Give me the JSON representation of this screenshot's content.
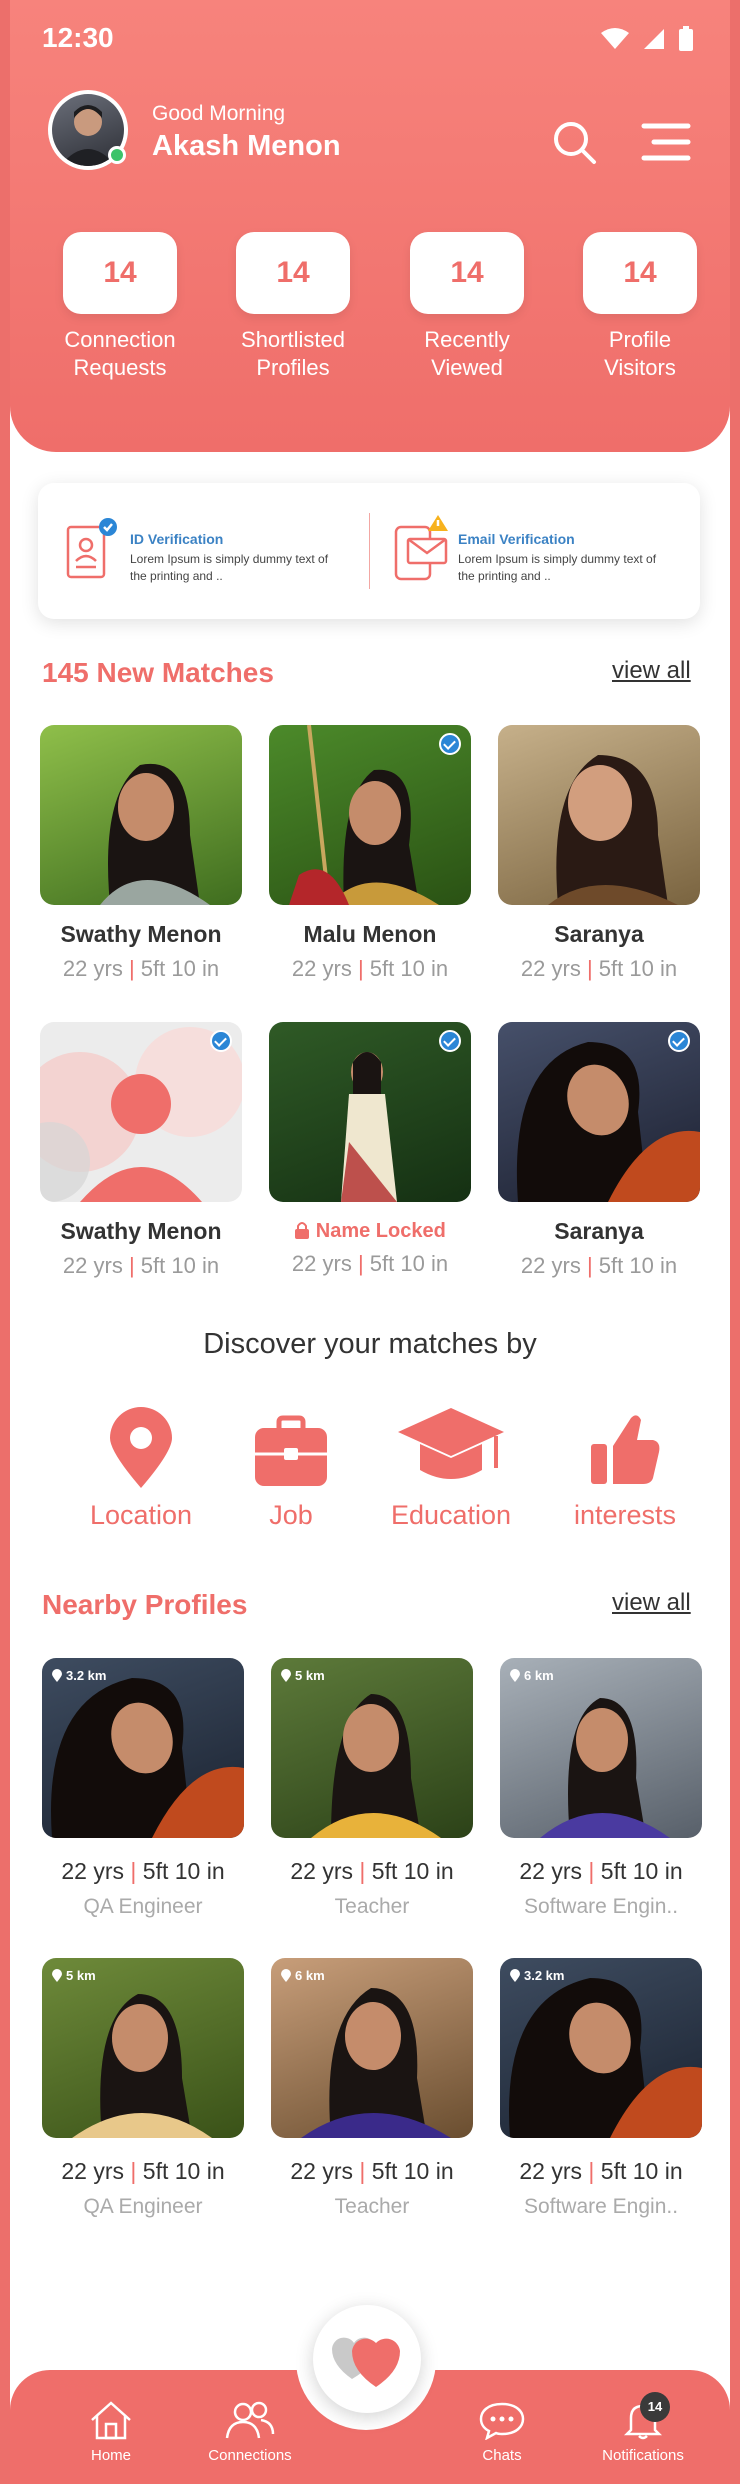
{
  "status_bar": {
    "time": "12:30"
  },
  "header": {
    "greeting": "Good Morning",
    "user_name": "Akash Menon",
    "stats": [
      {
        "value": "14",
        "label_line1": "Connection",
        "label_line2": "Requests"
      },
      {
        "value": "14",
        "label_line1": "Shortlisted",
        "label_line2": "Profiles"
      },
      {
        "value": "14",
        "label_line1": "Recently",
        "label_line2": "Viewed"
      },
      {
        "value": "14",
        "label_line1": "Profile",
        "label_line2": "Visitors"
      }
    ]
  },
  "verification": [
    {
      "title": "ID Verification",
      "desc": "Lorem Ipsum is simply dummy text of the printing and .."
    },
    {
      "title": "Email Verification",
      "desc": "Lorem Ipsum is simply dummy text of the printing and .."
    }
  ],
  "new_matches": {
    "title": "145 New Matches",
    "view_all": "view all",
    "items": [
      {
        "name": "Swathy Menon",
        "age": "22 yrs",
        "height": "5ft 10 in",
        "verified": false
      },
      {
        "name": "Malu Menon",
        "age": "22 yrs",
        "height": "5ft 10 in",
        "verified": true
      },
      {
        "name": "Saranya",
        "age": "22 yrs",
        "height": "5ft 10 in",
        "verified": false
      },
      {
        "name": "Swathy Menon",
        "age": "22 yrs",
        "height": "5ft 10 in",
        "verified": true
      },
      {
        "name": "Name Locked",
        "age": "22 yrs",
        "height": "5ft 10 in",
        "verified": true,
        "locked": true
      },
      {
        "name": "Saranya",
        "age": "22 yrs",
        "height": "5ft 10 in",
        "verified": true
      }
    ],
    "separator": "|"
  },
  "discover": {
    "title": "Discover your matches by",
    "items": [
      {
        "label": "Location",
        "icon": "map-pin-icon"
      },
      {
        "label": "Job",
        "icon": "briefcase-icon"
      },
      {
        "label": "Education",
        "icon": "graduation-cap-icon"
      },
      {
        "label": "interests",
        "icon": "thumbs-up-icon"
      }
    ]
  },
  "nearby": {
    "title": "Nearby Profiles",
    "view_all": "view all",
    "items": [
      {
        "distance": "3.2 km",
        "age": "22 yrs",
        "height": "5ft 10 in",
        "job": "QA Engineer"
      },
      {
        "distance": "5 km",
        "age": "22 yrs",
        "height": "5ft 10 in",
        "job": "Teacher"
      },
      {
        "distance": "6 km",
        "age": "22 yrs",
        "height": "5ft 10 in",
        "job": "Software Engin.."
      },
      {
        "distance": "5 km",
        "age": "22 yrs",
        "height": "5ft 10 in",
        "job": "QA Engineer"
      },
      {
        "distance": "6 km",
        "age": "22 yrs",
        "height": "5ft 10 in",
        "job": "Teacher"
      },
      {
        "distance": "3.2 km",
        "age": "22 yrs",
        "height": "5ft 10 in",
        "job": "Software Engin.."
      }
    ]
  },
  "bottom_nav": {
    "items": [
      {
        "label": "Home",
        "icon": "home-icon"
      },
      {
        "label": "Connections",
        "icon": "people-icon"
      },
      {
        "label": "Chats",
        "icon": "chat-icon"
      },
      {
        "label": "Notifications",
        "icon": "bell-icon"
      }
    ],
    "notification_badge": "14"
  },
  "colors": {
    "primary": "#ef6e6a",
    "verified": "#2b86d6",
    "link": "#3b82c4"
  }
}
